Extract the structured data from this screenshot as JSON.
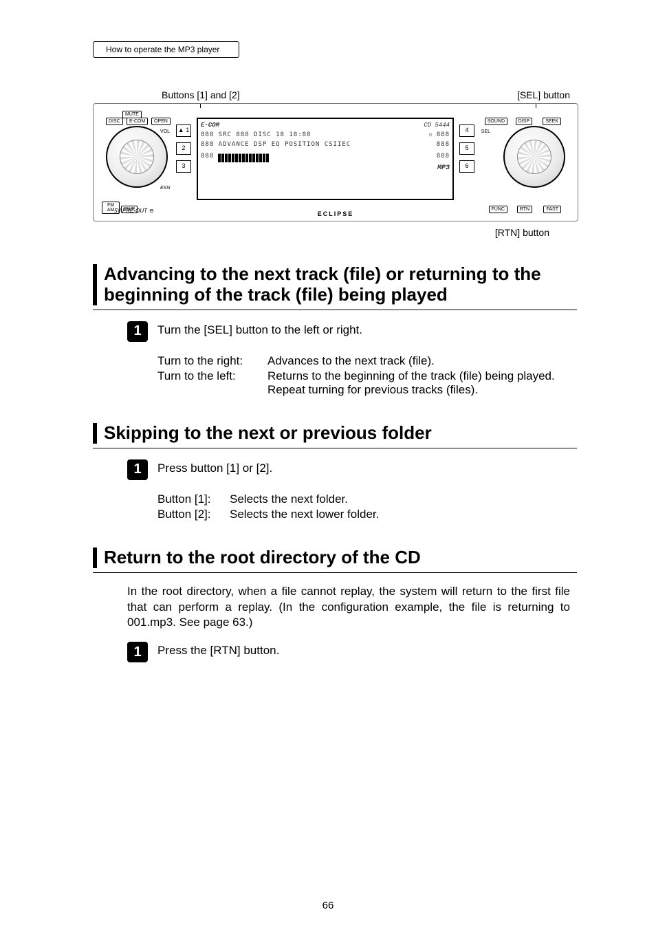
{
  "header_tab": "How to operate the MP3 player",
  "diagram": {
    "label_left": "Buttons [1] and [2]",
    "label_right": "[SEL] button",
    "label_below": "[RTN] button",
    "brand_inside": "E-COM",
    "model": "CD 5444",
    "footer_brand": "ECLIPSE",
    "left_btns_top": [
      "DISC",
      "E-COM",
      "OPEN"
    ],
    "left_labels": [
      "MUTE",
      "VOL",
      "ESN"
    ],
    "right_btns_top": [
      "SOUND",
      "DISP",
      "SEEK"
    ],
    "right_labels": [
      "SEL",
      "FUNC",
      "RTN",
      "FAST"
    ],
    "bottom_left_btns": [
      "FM AM",
      "PWR"
    ],
    "preout": "5V PRE-OUT",
    "num_left": [
      "1",
      "2",
      "3"
    ],
    "num_right": [
      "4",
      "5",
      "6"
    ],
    "lcd_line1": "888  SRC 888 DISC 18  18:88",
    "lcd_line2": "888  ADVANCE DSP EQ POSITION CSIIEC",
    "lcd_line3": "888",
    "right_888": [
      "888",
      "888",
      "888"
    ],
    "mp3": "MP3"
  },
  "section1": {
    "title": "Advancing to the next track (file) or returning to the beginning of the track (file) being played",
    "step1_num": "1",
    "step1_text": "Turn the [SEL] button to the left or right.",
    "right_label": "Turn to the right:",
    "right_value": "Advances to the next track (file).",
    "left_label": "Turn to the left:",
    "left_value1": "Returns to the beginning of the track (file) being played.",
    "left_value2": "Repeat turning for previous tracks (files)."
  },
  "section2": {
    "title": "Skipping to the next or previous folder",
    "step1_num": "1",
    "step1_text": "Press button [1] or [2].",
    "b1_label": "Button [1]:",
    "b1_value": "Selects the next folder.",
    "b2_label": "Button [2]:",
    "b2_value": "Selects the next lower folder."
  },
  "section3": {
    "title": "Return to the root directory of the CD",
    "intro": "In the root directory, when a file cannot replay, the system will return to the first file that can perform a replay. (In the configuration example, the file is returning to 001.mp3. See page 63.)",
    "step1_num": "1",
    "step1_text": "Press the [RTN] button."
  },
  "page_number": "66"
}
